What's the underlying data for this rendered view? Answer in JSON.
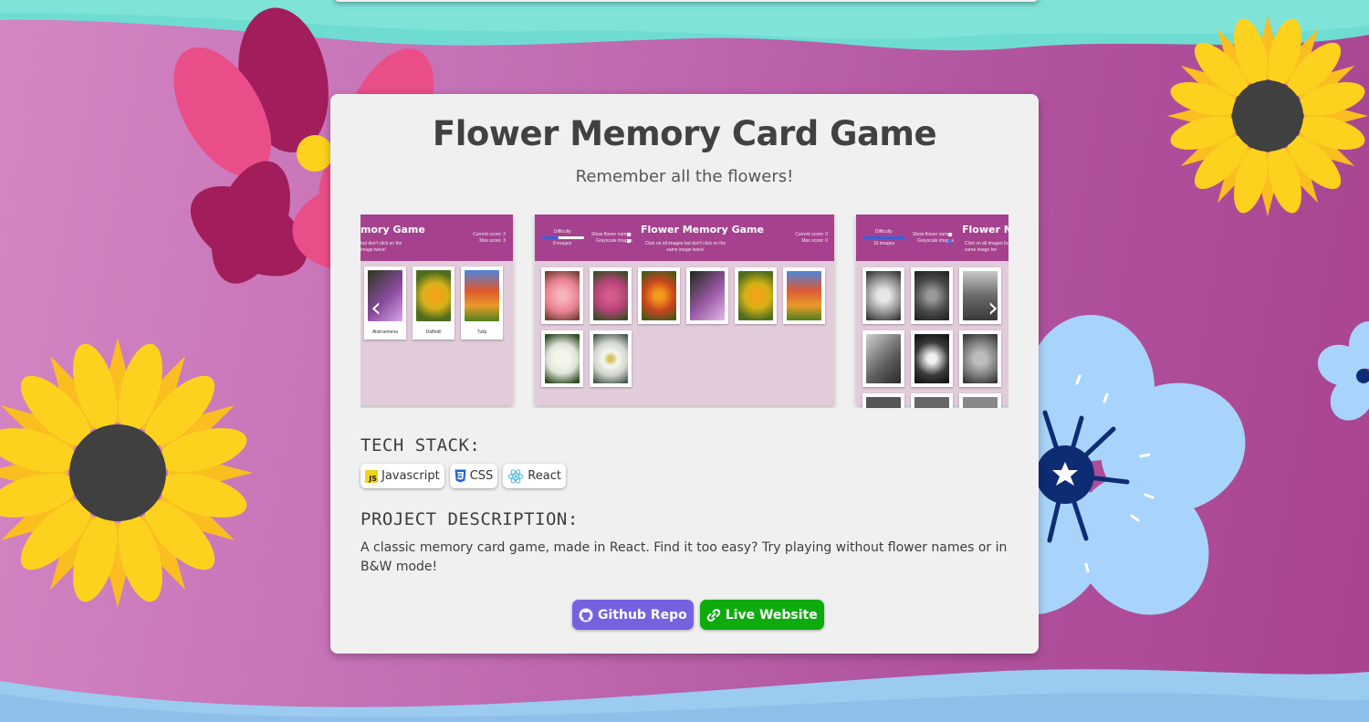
{
  "colors": {
    "card_bg": "#f1f0f1",
    "slide_header": "#a5418e",
    "github_button": "#7661e0",
    "live_button": "#0eab0e",
    "sunflower_petal": "#fdd21f",
    "sunflower_center": "#404040",
    "pink_petal": "#ea4e88",
    "blue_petal": "#a8d4fb",
    "navy_center": "#0e2c74"
  },
  "project": {
    "title": "Flower Memory Card Game",
    "subtitle": "Remember all the flowers!"
  },
  "carousel": {
    "prev_icon": "chevron-left-icon",
    "next_icon": "chevron-right-icon",
    "slides": [
      {
        "header_title": "mory Game",
        "header_note": "but don't click on the\nimage twice!",
        "score_line1": "Current score: 3",
        "score_line2": "Max score: 3",
        "cards": [
          {
            "caption": "Alstroemeria",
            "color": "#8a4a9e"
          },
          {
            "caption": "Daffodil",
            "color": "#d8b21a"
          },
          {
            "caption": "Tulip",
            "color": "#e0572e"
          }
        ]
      },
      {
        "header_title": "Flower Memory Game",
        "difficulty_label": "Difficulty",
        "difficulty_value": "8 images",
        "toggle1": "Show flower names",
        "toggle2": "Grayscale images",
        "header_note": "Click on all images but don't click on the\nsame image twice!",
        "score_line1": "Current score: 0",
        "score_line2": "Max score: 0",
        "cards": [
          {
            "color": "#e77f8f"
          },
          {
            "color": "#b54377"
          },
          {
            "color": "#c9451e"
          },
          {
            "color": "#9a59a6"
          },
          {
            "color": "#d5b114"
          },
          {
            "color": "#dc5a35"
          },
          {
            "color": "#dfe3d8"
          },
          {
            "color": "#d3d6cc"
          }
        ]
      },
      {
        "header_title": "Flower Mem",
        "difficulty_label": "Difficulty",
        "difficulty_value": "16 images",
        "toggle1": "Show flower names",
        "toggle2": "Grayscale images",
        "header_note": "Click on all images bu\nsame image twi",
        "cards": [
          {
            "color": "#8d8d8d"
          },
          {
            "color": "#4a4a4a"
          },
          {
            "color": "#6a6a6a"
          },
          {
            "color": "#5c5c5c"
          },
          {
            "color": "#3a3a3a"
          },
          {
            "color": "#777777"
          },
          {
            "color": "#555555"
          },
          {
            "color": "#666666"
          },
          {
            "color": "#888888"
          }
        ]
      }
    ]
  },
  "tech_stack": {
    "heading": "TECH STACK:",
    "items": [
      {
        "label": "Javascript",
        "icon": "javascript-icon",
        "icon_text": "JS"
      },
      {
        "label": "CSS",
        "icon": "css-icon"
      },
      {
        "label": "React",
        "icon": "react-icon"
      }
    ]
  },
  "description": {
    "heading": "PROJECT DESCRIPTION:",
    "text": "A classic memory card game, made in React. Find it too easy? Try playing without flower names or in B&W mode!"
  },
  "links": {
    "github_label": "Github Repo",
    "github_icon": "github-icon",
    "live_label": "Live Website",
    "live_icon": "link-icon"
  }
}
